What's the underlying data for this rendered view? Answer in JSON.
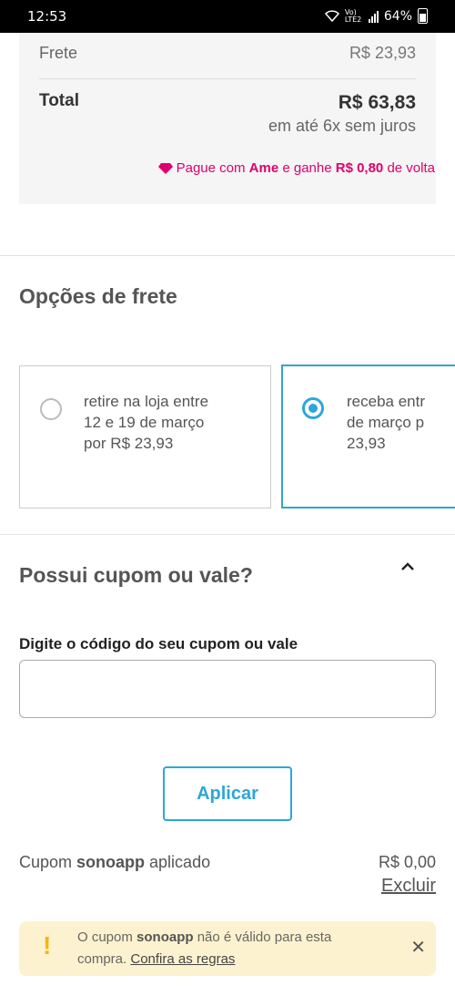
{
  "status_bar": {
    "time": "12:53",
    "network": "Vo) LTE2",
    "battery": "64%"
  },
  "summary": {
    "frete_label": "Frete",
    "frete_value": "R$ 23,93",
    "total_label": "Total",
    "total_value": "R$ 63,83",
    "installments": "em até 6x sem juros",
    "ame_prefix": "Pague com ",
    "ame_brand": "Ame",
    "ame_mid": " e ganhe ",
    "ame_amount": "R$ 0,80",
    "ame_suffix": " de volta"
  },
  "shipping": {
    "title": "Opções de frete",
    "options": [
      {
        "line1": "retire na loja entre",
        "line2": "12 e 19 de março",
        "line3": "por R$ 23,93",
        "selected": false
      },
      {
        "line1": "receba entr",
        "line2": "de março p",
        "line3": "23,93",
        "selected": true
      }
    ]
  },
  "coupon": {
    "title": "Possui cupom ou vale?",
    "field_label": "Digite o código do seu cupom ou vale",
    "input_value": "",
    "apply_label": "Aplicar",
    "applied_prefix": "Cupom ",
    "applied_code": "sonoapp",
    "applied_suffix": " aplicado",
    "applied_value": "R$ 0,00",
    "remove_label": "Excluir"
  },
  "alert": {
    "text_prefix": "O cupom ",
    "code": "sonoapp",
    "text_mid": " não é válido para esta compra. ",
    "link": "Confira as regras",
    "icon": "exclamation-icon",
    "close_icon": "close-icon"
  },
  "colors": {
    "accent": "#2ea6d8",
    "ame": "#e0006c",
    "alert_bg": "#fdf2cf",
    "alert_icon": "#f2b813"
  }
}
